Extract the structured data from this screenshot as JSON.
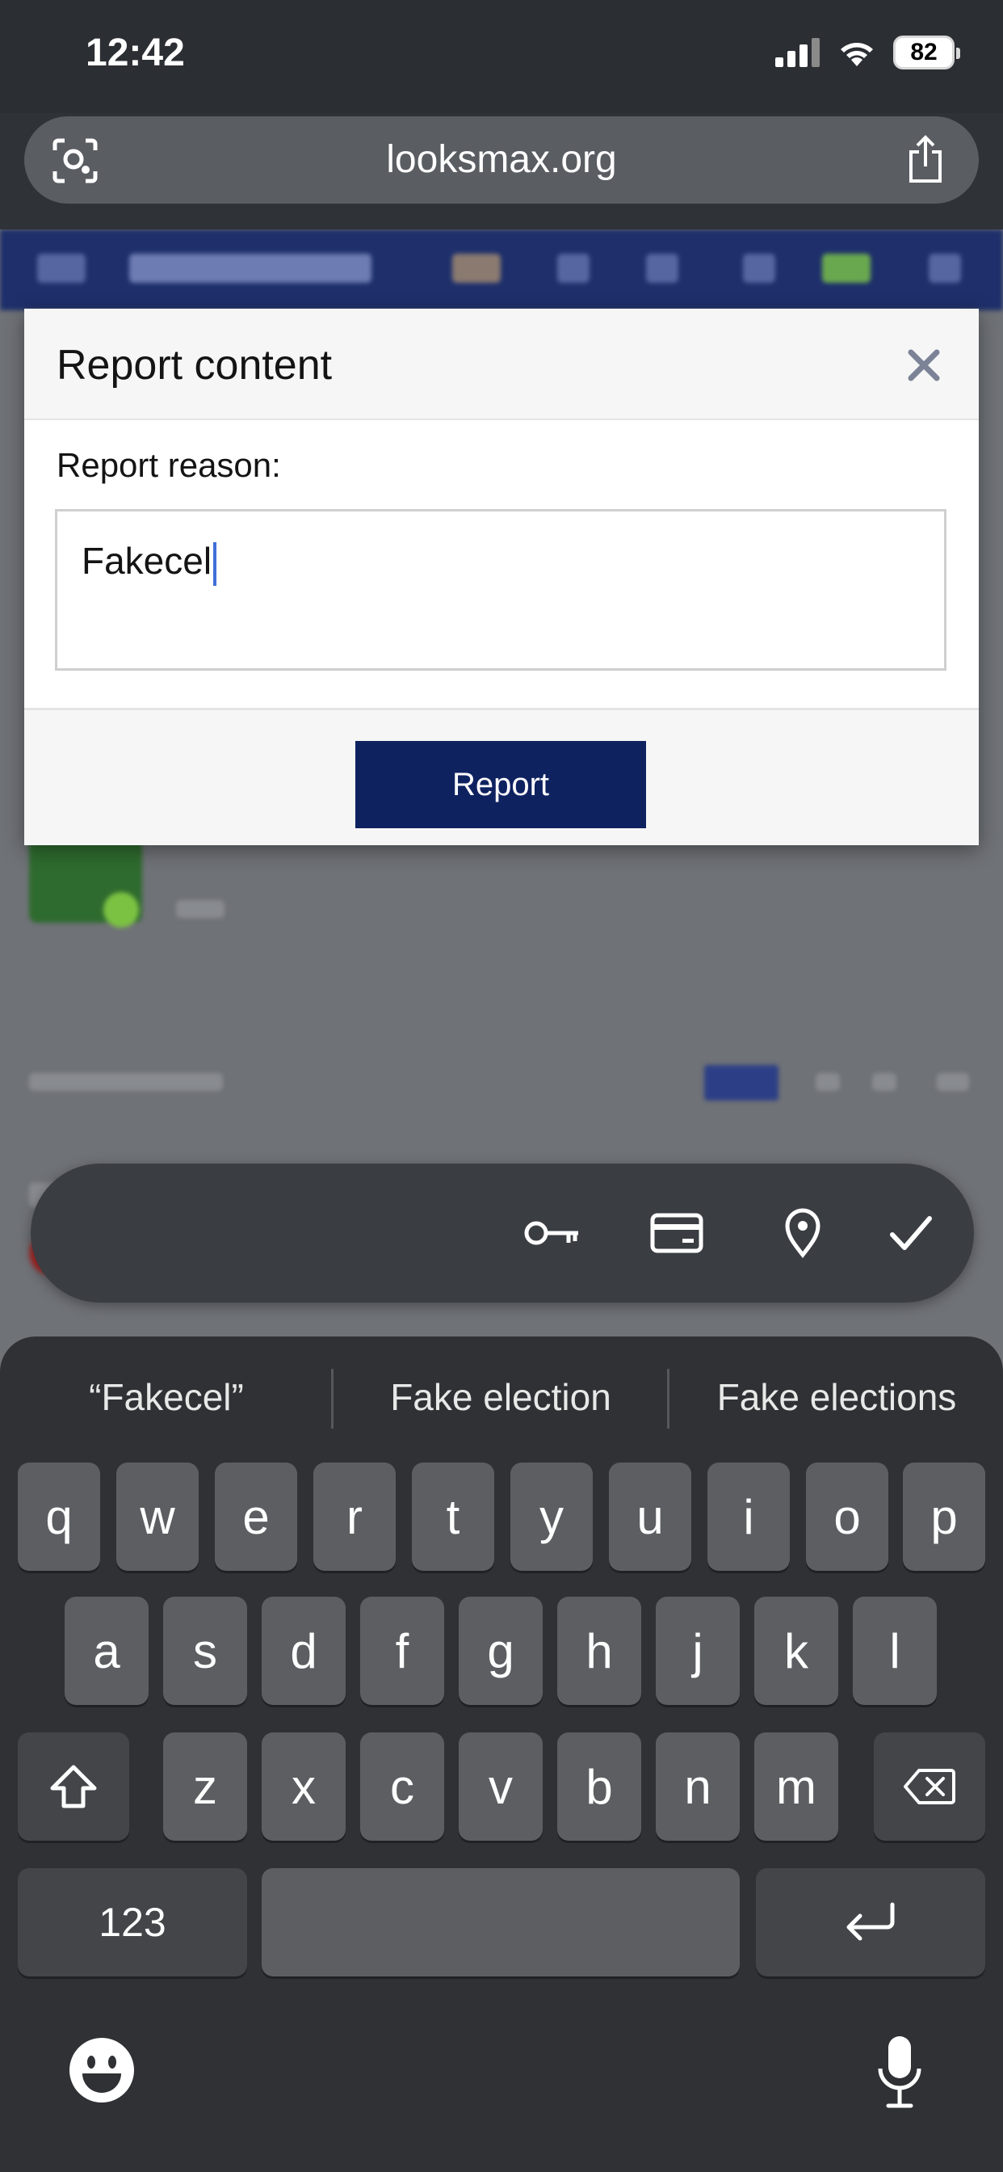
{
  "status_bar": {
    "time": "12:42",
    "battery": "82"
  },
  "browser": {
    "url": "looksmax.org"
  },
  "modal": {
    "title": "Report content",
    "reason_label": "Report reason:",
    "reason_value": "Fakecel",
    "submit_label": "Report"
  },
  "keyboard": {
    "suggestions": [
      "“Fakecel”",
      "Fake election",
      "Fake elections"
    ],
    "row1": [
      "q",
      "w",
      "e",
      "r",
      "t",
      "y",
      "u",
      "i",
      "o",
      "p"
    ],
    "row2": [
      "a",
      "s",
      "d",
      "f",
      "g",
      "h",
      "j",
      "k",
      "l"
    ],
    "row3": [
      "z",
      "x",
      "c",
      "v",
      "b",
      "n",
      "m"
    ],
    "numbers_label": "123"
  },
  "colors": {
    "accent": "#0f2260",
    "caret": "#3f6fd8"
  }
}
